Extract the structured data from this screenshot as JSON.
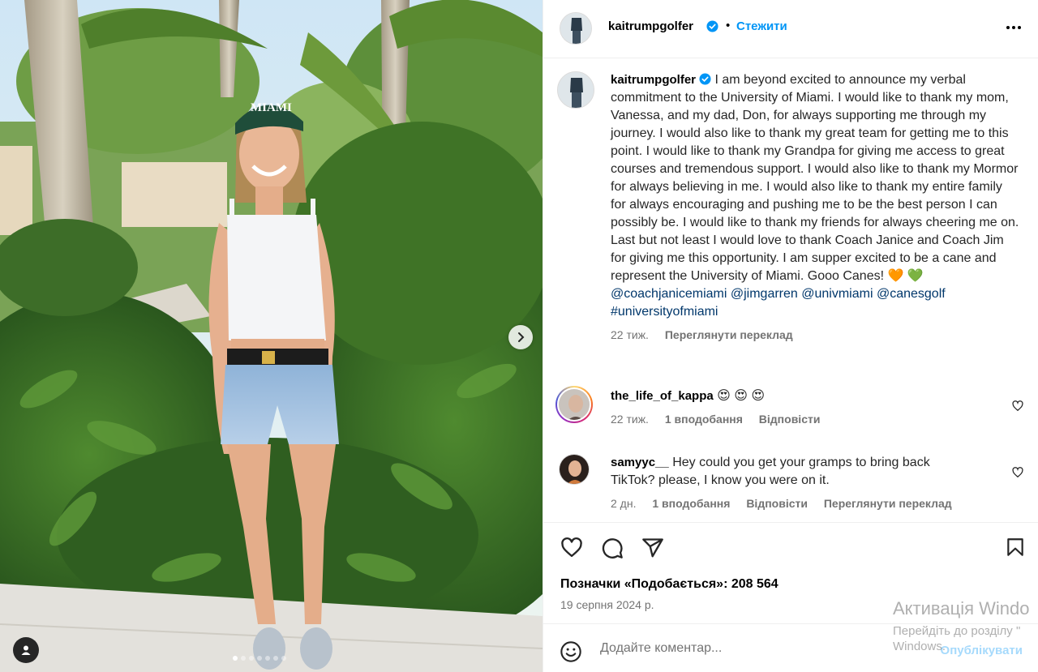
{
  "post": {
    "username": "kaitrumpgolfer",
    "separator": "•",
    "follow_label": "Стежити",
    "caption_text": "I am beyond excited to announce my verbal commitment to the University of Miami. I would like to thank my mom, Vanessa, and my dad, Don, for always supporting me through my journey. I would also like to thank my great team for getting me to this point. I would like to thank my Grandpa for giving me access to great courses and tremendous support. I would also like to thank my Mormor for always believing in me. I would also like to thank my entire family for always encouraging and pushing me to be the best person I can possibly be. I would like to thank my friends for always cheering me on. Last but not least I would love to thank Coach Janice and Coach Jim for giving me this opportunity. I am supper excited to be a cane and represent the University of Miami. Gooo Canes! 🧡 💚",
    "mentions": [
      "@coachjanicemiami",
      "@jimgarren",
      "@univmiami",
      "@canesgolf"
    ],
    "hashtag": "#universityofmiami",
    "caption_age": "22 тиж.",
    "see_translation": "Переглянути переклад",
    "hat_text": "MIAMI",
    "media_dots": 7,
    "media_active_dot": 0
  },
  "comments": [
    {
      "username": "the_life_of_kappa",
      "text": "😍 😍 😍",
      "age": "22 тиж.",
      "likes": "1 вподобання",
      "reply": "Відповісти",
      "translate": ""
    },
    {
      "username": "samyyc__",
      "text": "Hey could you get your gramps to bring back TikTok? please, I know you were on it.",
      "age": "2 дн.",
      "likes": "1 вподобання",
      "reply": "Відповісти",
      "translate": "Переглянути переклад"
    }
  ],
  "footer": {
    "likes_label": "Позначки «Подобається»: 208 564",
    "date": "19 серпня 2024 р.",
    "comment_placeholder": "Додайте коментар...",
    "post_label": "Опублікувати"
  },
  "watermark": {
    "line1": "Активація Windo",
    "line2": "Перейдіть до розділу \"",
    "line3": "Windows."
  },
  "icons": {
    "verified": "verified-badge-icon",
    "more": "more-horizontal-icon",
    "like": "heart-icon",
    "comment": "comment-bubble-icon",
    "share": "share-paper-plane-icon",
    "save": "bookmark-icon",
    "emoji": "smiley-icon",
    "next": "chevron-right-icon",
    "tagged": "user-tag-icon"
  },
  "colors": {
    "link_blue": "#0095f6",
    "mention_blue": "#00376b",
    "verified_blue": "#0095f6",
    "muted": "#737373"
  }
}
